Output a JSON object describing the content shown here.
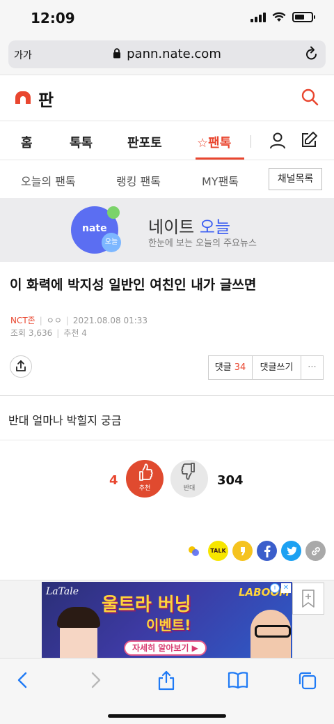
{
  "status_bar": {
    "time": "12:09"
  },
  "browser": {
    "aa_label": "가가",
    "url": "pann.nate.com"
  },
  "site": {
    "logo_text": "판"
  },
  "nav": {
    "items": [
      "홈",
      "톡톡",
      "판포토",
      "☆팬톡"
    ],
    "active_index": 3
  },
  "subnav": {
    "items": [
      "오늘의 팬톡",
      "랭킹 팬톡",
      "MY팬톡"
    ],
    "channel_button": "채널목록"
  },
  "banner": {
    "logo": "nate",
    "badge": "오늘",
    "title_part1": "네이트 ",
    "title_part2": "오늘",
    "description": "한눈에 보는 오늘의 주요뉴스"
  },
  "article": {
    "title": "이 화력에 박지성 일반인 여친인 내가 글쓰면",
    "author": "NCT존",
    "anon": "ㅇㅇ",
    "datetime": "2021.08.08 01:33",
    "views_label": "조회",
    "views": "3,636",
    "recommend_label": "추천",
    "recommend": "4",
    "body": "반대 얼마나 박힐지 궁금"
  },
  "actions": {
    "comment_label": "댓글",
    "comment_count": "34",
    "write_comment": "댓글쓰기",
    "more": "···"
  },
  "vote": {
    "up_count": "4",
    "up_label": "추천",
    "down_label": "반대",
    "down_count": "304"
  },
  "sns": [
    {
      "name": "nate-icon",
      "bg": "#ffffff"
    },
    {
      "name": "kakaotalk-icon",
      "bg": "#f7e600",
      "text": "TALK"
    },
    {
      "name": "kakaostory-icon",
      "bg": "#f5c31f"
    },
    {
      "name": "facebook-icon",
      "bg": "#3b5ecb"
    },
    {
      "name": "twitter-icon",
      "bg": "#1da1f2"
    },
    {
      "name": "link-icon",
      "bg": "#a9a9a9"
    }
  ],
  "ad": {
    "logo": "LaTale",
    "headline": "울트라 버닝",
    "subline": "이벤트!",
    "brand2": "LABOOM",
    "cta": "자세히 알아보기 ▶",
    "info": "i",
    "close": "✕"
  },
  "colors": {
    "accent": "#e9462f",
    "nate_blue": "#3d5ff2"
  }
}
